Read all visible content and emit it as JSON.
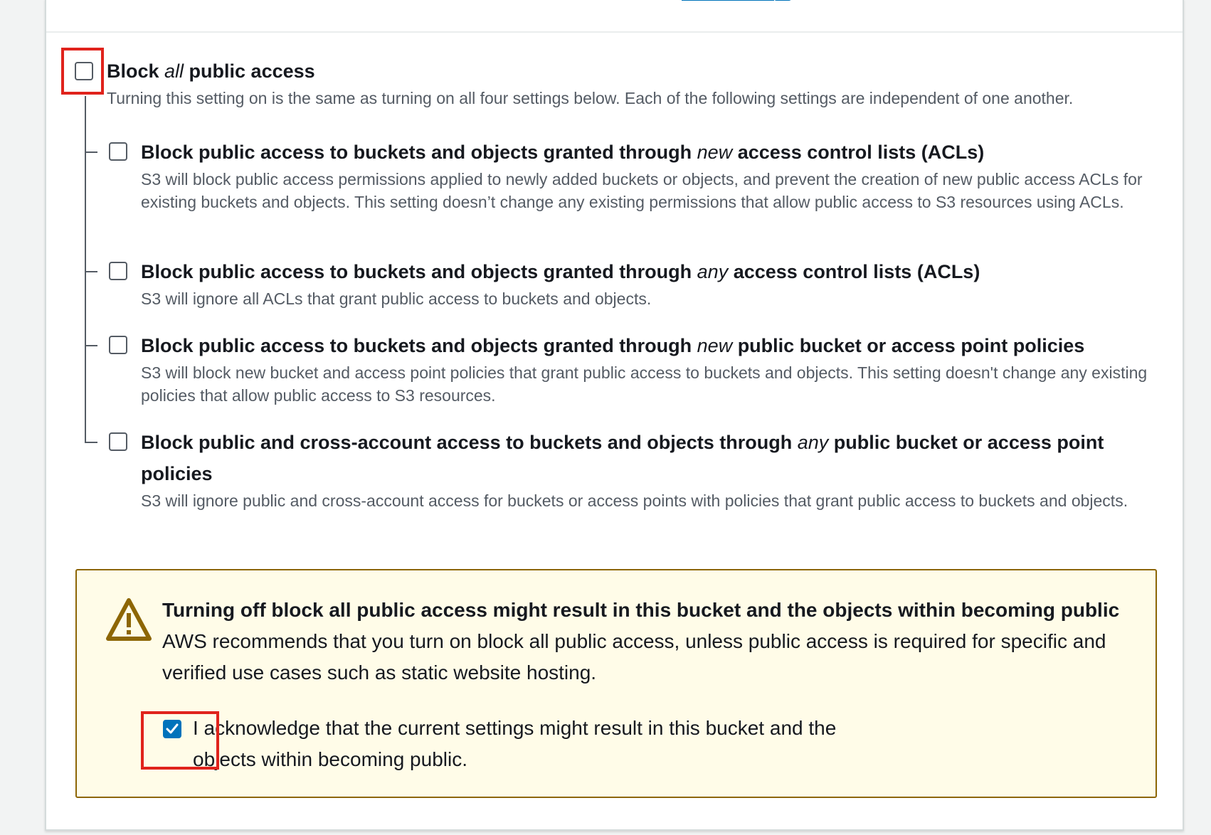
{
  "block_all": {
    "label_pre": "Block ",
    "label_em": "all",
    "label_post": " public access",
    "description": "Turning this setting on is the same as turning on all four settings below. Each of the following settings are independent of one another.",
    "checked": false
  },
  "options": [
    {
      "label_pre": "Block public access to buckets and objects granted through ",
      "label_em": "new",
      "label_post": " access control lists (ACLs)",
      "description": "S3 will block public access permissions applied to newly added buckets or objects, and prevent the creation of new public access ACLs for existing buckets and objects. This setting doesn’t change any existing permissions that allow public access to S3 resources using ACLs.",
      "checked": false
    },
    {
      "label_pre": "Block public access to buckets and objects granted through ",
      "label_em": "any",
      "label_post": " access control lists (ACLs)",
      "description": "S3 will ignore all ACLs that grant public access to buckets and objects.",
      "checked": false
    },
    {
      "label_pre": "Block public access to buckets and objects granted through ",
      "label_em": "new",
      "label_post": " public bucket or access point policies",
      "description": "S3 will block new bucket and access point policies that grant public access to buckets and objects. This setting doesn't change any existing policies that allow public access to S3 resources.",
      "checked": false
    },
    {
      "label_pre": "Block public and cross-account access to buckets and objects through ",
      "label_em": "any",
      "label_post": " public bucket or access point policies",
      "description": "S3 will ignore public and cross-account access for buckets or access points with policies that grant public access to buckets and objects.",
      "checked": false
    }
  ],
  "alert": {
    "icon": "warning-icon",
    "title": "Turning off block all public access might result in this bucket and the objects within becoming public",
    "text": "AWS recommends that you turn on block all public access, unless public access is required for specific and verified use cases such as static website hosting.",
    "acknowledge_label": "I acknowledge that the current settings might result in this bucket and the objects within becoming public.",
    "acknowledge_checked": true
  },
  "colors": {
    "highlight": "#e0231c",
    "checkbox_checked": "#0073bb",
    "alert_background": "#fffce8",
    "alert_border": "#8d6605"
  }
}
